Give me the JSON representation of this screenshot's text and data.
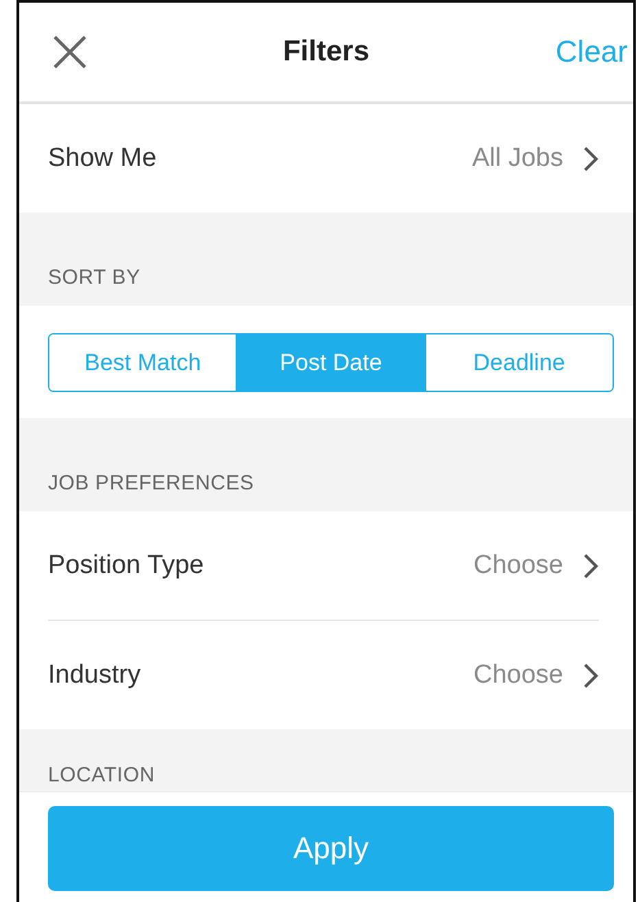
{
  "header": {
    "title": "Filters",
    "action": "Clear"
  },
  "sections": [
    {
      "kind": "row",
      "label": "Show Me",
      "value": "All Jobs"
    },
    {
      "kind": "heading",
      "label": "SORT BY"
    },
    {
      "kind": "segmented",
      "options": [
        {
          "label": "Best Match",
          "selected": false
        },
        {
          "label": "Post Date",
          "selected": true
        },
        {
          "label": "Deadline",
          "selected": false
        }
      ]
    },
    {
      "kind": "heading",
      "label": "JOB PREFERENCES"
    },
    {
      "kind": "row",
      "label": "Position Type",
      "value": "Choose"
    },
    {
      "kind": "row",
      "label": "Industry",
      "value": "Choose"
    },
    {
      "kind": "heading",
      "label": "LOCATION"
    }
  ],
  "footer": {
    "button": "Apply"
  }
}
